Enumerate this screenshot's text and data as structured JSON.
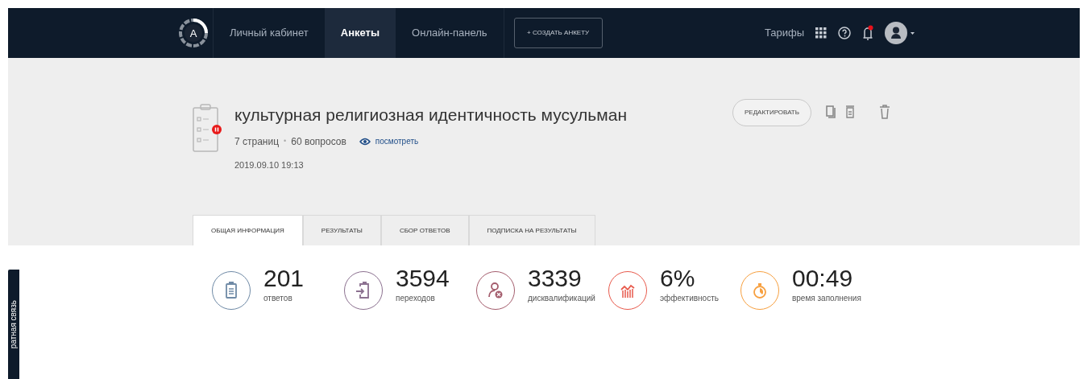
{
  "navbar": {
    "logo_letter": "A",
    "items": [
      {
        "label": "Личный кабинет",
        "selected": false
      },
      {
        "label": "Анкеты",
        "selected": true
      },
      {
        "label": "Онлайн-панель",
        "selected": false
      }
    ],
    "create_button": "+ СОЗДАТЬ АНКЕТУ",
    "tariffs": "Тарифы",
    "notification_unread": true
  },
  "survey": {
    "title": "культурная религиозная идентичность мусульман",
    "paused": true,
    "pages": "7 страниц",
    "separator": "•",
    "questions": "60 вопросов",
    "preview_link": "посмотреть",
    "date": "2019.09.10 19:13",
    "edit_button": "РЕДАКТИРОВАТЬ"
  },
  "tabs": [
    {
      "label": "ОБЩАЯ ИНФОРМАЦИЯ",
      "selected": true
    },
    {
      "label": "РЕЗУЛЬТАТЫ",
      "selected": false
    },
    {
      "label": "СБОР ОТВЕТОВ",
      "selected": false
    },
    {
      "label": "ПОДПИСКА НА РЕЗУЛЬТАТЫ",
      "selected": false
    }
  ],
  "stats": [
    {
      "kind": "answers",
      "value": "201",
      "label": "ответов",
      "color": "#6f8aa6"
    },
    {
      "kind": "visits",
      "value": "3594",
      "label": "переходов",
      "color": "#8c7190"
    },
    {
      "kind": "disqualified",
      "value": "3339",
      "label": "дисквалификаций",
      "color": "#a45d6d"
    },
    {
      "kind": "efficiency",
      "value": "6%",
      "label": "эффективность",
      "color": "#e85a4c"
    },
    {
      "kind": "time",
      "value": "00:49",
      "label": "время заполнения",
      "color": "#f7a040"
    }
  ],
  "feedback_tab": "ратная связь"
}
